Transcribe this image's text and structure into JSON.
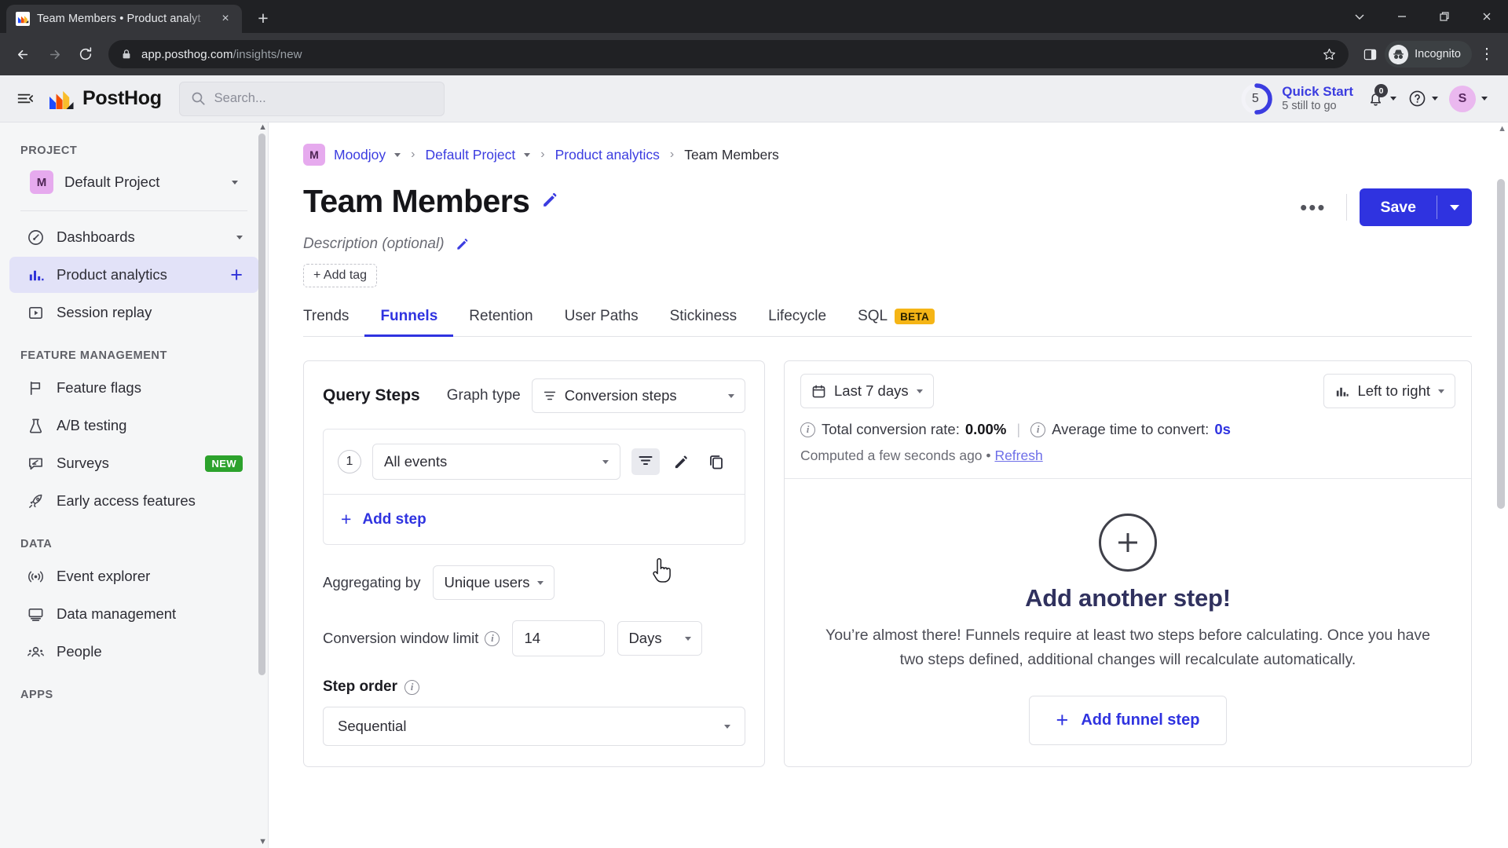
{
  "browser": {
    "tab": {
      "title": "Team Members • Product analyt",
      "favicon": "posthog-favicon",
      "close": "×"
    },
    "newtab_label": "+",
    "window": {
      "minimize": "—",
      "maximize": "❐",
      "close": "✕",
      "tab_search": "⌄"
    },
    "nav": {
      "back": "←",
      "forward": "→",
      "reload": "⟳"
    },
    "url": {
      "secure_icon": "lock-icon",
      "domain": "app.posthog.com",
      "path": "/insights/new"
    },
    "actions": {
      "bookmark": "star-icon",
      "sidepanel": "side-panel-icon",
      "menu": "⋮"
    },
    "incognito": {
      "label": "Incognito",
      "icon": "incognito-icon"
    }
  },
  "topbar": {
    "menu_toggle": "hamburger-collapse-icon",
    "brand": "PostHog",
    "search": {
      "placeholder": "Search...",
      "icon": "search-icon"
    },
    "quick_start": {
      "count": "5",
      "title": "Quick Start",
      "subtitle": "5 still to go",
      "progress_pct": 50
    },
    "notifications": {
      "icon": "bell-icon",
      "count": "0"
    },
    "help": {
      "icon": "question-circle-icon"
    },
    "account": {
      "initial": "S"
    }
  },
  "sidebar": {
    "sections": [
      {
        "label": "PROJECT",
        "project": {
          "badge": "M",
          "name": "Default Project"
        },
        "items": []
      },
      {
        "label": "",
        "items": [
          {
            "name": "dashboards",
            "icon": "gauge-icon",
            "label": "Dashboards",
            "trailing": "caret",
            "active": false
          },
          {
            "name": "product-analytics",
            "icon": "bar-chart-icon",
            "label": "Product analytics",
            "trailing": "plus",
            "active": true
          },
          {
            "name": "session-replay",
            "icon": "play-box-icon",
            "label": "Session replay",
            "trailing": "",
            "active": false
          }
        ]
      },
      {
        "label": "FEATURE MANAGEMENT",
        "items": [
          {
            "name": "feature-flags",
            "icon": "flag-icon",
            "label": "Feature flags",
            "trailing": "",
            "active": false
          },
          {
            "name": "ab-testing",
            "icon": "flask-icon",
            "label": "A/B testing",
            "trailing": "",
            "active": false
          },
          {
            "name": "surveys",
            "icon": "survey-icon",
            "label": "Surveys",
            "trailing": "badge",
            "badge": "NEW",
            "active": false
          },
          {
            "name": "early-access-features",
            "icon": "rocket-icon",
            "label": "Early access features",
            "trailing": "",
            "active": false
          }
        ]
      },
      {
        "label": "DATA",
        "items": [
          {
            "name": "event-explorer",
            "icon": "signal-icon",
            "label": "Event explorer",
            "trailing": "",
            "active": false
          },
          {
            "name": "data-management",
            "icon": "monitor-icon",
            "label": "Data management",
            "trailing": "",
            "active": false
          },
          {
            "name": "people",
            "icon": "people-icon",
            "label": "People",
            "trailing": "",
            "active": false
          }
        ]
      },
      {
        "label": "APPS",
        "items": []
      }
    ]
  },
  "breadcrumb": {
    "org_badge": "M",
    "items": [
      {
        "label": "Moodjoy",
        "link": true,
        "caret": true
      },
      {
        "label": "Default Project",
        "link": true,
        "caret": true
      },
      {
        "label": "Product analytics",
        "link": true,
        "caret": false
      },
      {
        "label": "Team Members",
        "link": false,
        "caret": false
      }
    ],
    "separator": "›"
  },
  "page": {
    "title": "Team Members",
    "title_edit_icon": "pencil-icon",
    "description_placeholder": "Description (optional)",
    "description_edit_icon": "pencil-icon",
    "add_tag_label": "+ Add tag",
    "more_actions": "•••",
    "save_label": "Save",
    "save_caret": "chevron-down-icon"
  },
  "tabs": {
    "items": [
      {
        "label": "Trends",
        "active": false
      },
      {
        "label": "Funnels",
        "active": true
      },
      {
        "label": "Retention",
        "active": false
      },
      {
        "label": "User Paths",
        "active": false
      },
      {
        "label": "Stickiness",
        "active": false
      },
      {
        "label": "Lifecycle",
        "active": false
      },
      {
        "label": "SQL",
        "active": false,
        "badge": "BETA"
      }
    ]
  },
  "query_steps": {
    "heading": "Query Steps",
    "graph_type_label": "Graph type",
    "graph_type_value": "Conversion steps",
    "graph_type_icon": "funnel-icon",
    "steps": [
      {
        "number": "1",
        "event": "All events",
        "actions": [
          {
            "name": "filter-icon",
            "hovered": true
          },
          {
            "name": "pencil-icon",
            "hovered": false
          },
          {
            "name": "duplicate-icon",
            "hovered": false
          }
        ]
      }
    ],
    "add_step_label": "Add step",
    "aggregating_by_label": "Aggregating by",
    "aggregating_by_value": "Unique users",
    "conversion_window_label": "Conversion window limit",
    "conversion_window_value": "14",
    "conversion_window_unit": "Days",
    "step_order_label": "Step order",
    "step_order_value": "Sequential"
  },
  "results": {
    "date_range": "Last 7 days",
    "date_range_icon": "calendar-icon",
    "layout": "Left to right",
    "layout_icon": "bar-chart-icon",
    "total_conversion_label": "Total conversion rate:",
    "total_conversion_value": "0.00%",
    "avg_time_label": "Average time to convert:",
    "avg_time_value": "0s",
    "computed_text": "Computed a few seconds ago",
    "computed_sep": "•",
    "refresh_label": "Refresh",
    "empty": {
      "icon": "plus-circle-icon",
      "title": "Add another step!",
      "body": "You’re almost there! Funnels require at least two steps before calculating. Once you have two steps defined, additional changes will recalculate automatically.",
      "button_label": "Add funnel step"
    }
  },
  "colors": {
    "accent_blue": "#2f33e0",
    "link_blue": "#3b3ce0",
    "sidebar_active_bg": "#e2e2f8",
    "badge_new_green": "#2ca22c",
    "badge_beta_yellow": "#f5b516",
    "avatar_purple": "#eab8ef",
    "chrome_dark": "#35363a"
  }
}
